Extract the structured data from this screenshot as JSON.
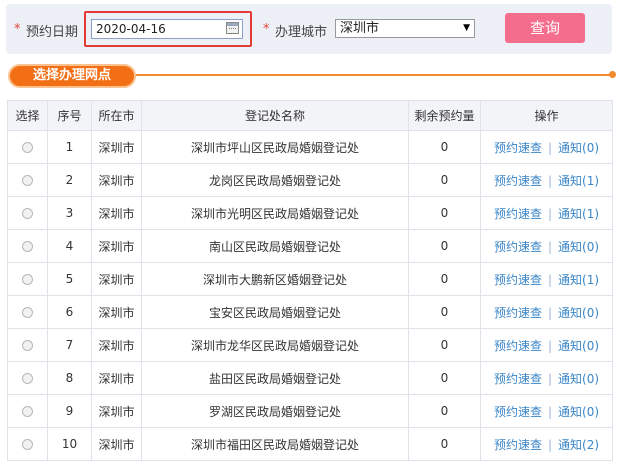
{
  "search": {
    "required_mark": "*",
    "date_label": "预约日期",
    "date_value": "2020-04-16",
    "city_label": "办理城市",
    "city_value": "深圳市",
    "query_label": "查询"
  },
  "section": {
    "title": "选择办理网点"
  },
  "table": {
    "headers": [
      "选择",
      "序号",
      "所在市",
      "登记处名称",
      "剩余预约量",
      "操作"
    ],
    "action_book_label": "预约速查",
    "action_separator": "|",
    "rows": [
      {
        "index": "1",
        "city": "深圳市",
        "name": "深圳市坪山区民政局婚姻登记处",
        "remaining": "0",
        "notice": "通知(0)"
      },
      {
        "index": "2",
        "city": "深圳市",
        "name": "龙岗区民政局婚姻登记处",
        "remaining": "0",
        "notice": "通知(1)"
      },
      {
        "index": "3",
        "city": "深圳市",
        "name": "深圳市光明区民政局婚姻登记处",
        "remaining": "0",
        "notice": "通知(1)"
      },
      {
        "index": "4",
        "city": "深圳市",
        "name": "南山区民政局婚姻登记处",
        "remaining": "0",
        "notice": "通知(0)"
      },
      {
        "index": "5",
        "city": "深圳市",
        "name": "深圳市大鹏新区婚姻登记处",
        "remaining": "0",
        "notice": "通知(1)"
      },
      {
        "index": "6",
        "city": "深圳市",
        "name": "宝安区民政局婚姻登记处",
        "remaining": "0",
        "notice": "通知(0)"
      },
      {
        "index": "7",
        "city": "深圳市",
        "name": "深圳市龙华区民政局婚姻登记处",
        "remaining": "0",
        "notice": "通知(0)"
      },
      {
        "index": "8",
        "city": "深圳市",
        "name": "盐田区民政局婚姻登记处",
        "remaining": "0",
        "notice": "通知(0)"
      },
      {
        "index": "9",
        "city": "深圳市",
        "name": "罗湖区民政局婚姻登记处",
        "remaining": "0",
        "notice": "通知(0)"
      },
      {
        "index": "10",
        "city": "深圳市",
        "name": "深圳市福田区民政局婚姻登记处",
        "remaining": "0",
        "notice": "通知(2)"
      }
    ]
  }
}
